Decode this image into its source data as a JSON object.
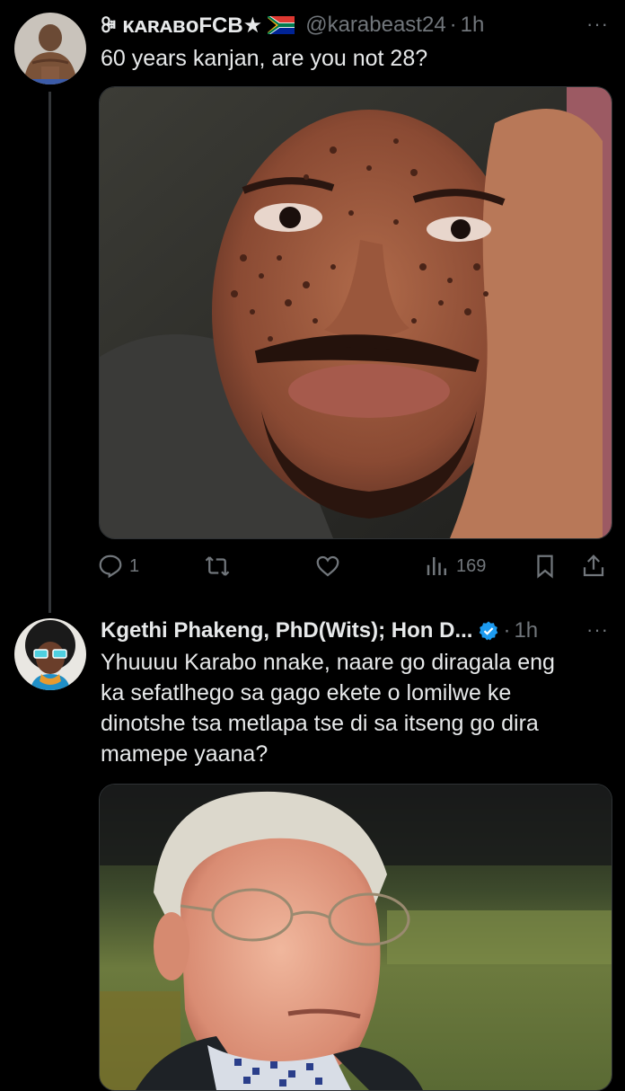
{
  "tweet1": {
    "display_name": "ꔭ ᴋᴀʀᴀʙᴏFCB★",
    "flag_icon": "south-africa-flag-icon",
    "handle": "@karabeast24",
    "separator": "·",
    "time": "1h",
    "more_label": "···",
    "text": "60 years kanjan, are you not 28?",
    "media_alt": "selfie-photo",
    "actions": {
      "reply_count": "1",
      "retweet_count": "",
      "like_count": "",
      "views_count": "169"
    }
  },
  "tweet2": {
    "display_name": "Kgethi Phakeng, PhD(Wits); Hon D...",
    "verified_icon": "verified-badge-icon",
    "separator": "·",
    "time": "1h",
    "more_label": "···",
    "text": "Yhuuuu Karabo nnake, naare go diragala eng\nka sefatlhego sa gago ekete o lomilwe ke\ndinotshe tsa metlapa tse di sa itseng go dira\nmamepe yaana?",
    "media_alt": "gif-man-in-glasses"
  },
  "colors": {
    "background": "#000000",
    "text_primary": "#e7e9ea",
    "text_secondary": "#71767b",
    "verified_blue": "#1d9bf0",
    "divider": "#2f3336"
  }
}
